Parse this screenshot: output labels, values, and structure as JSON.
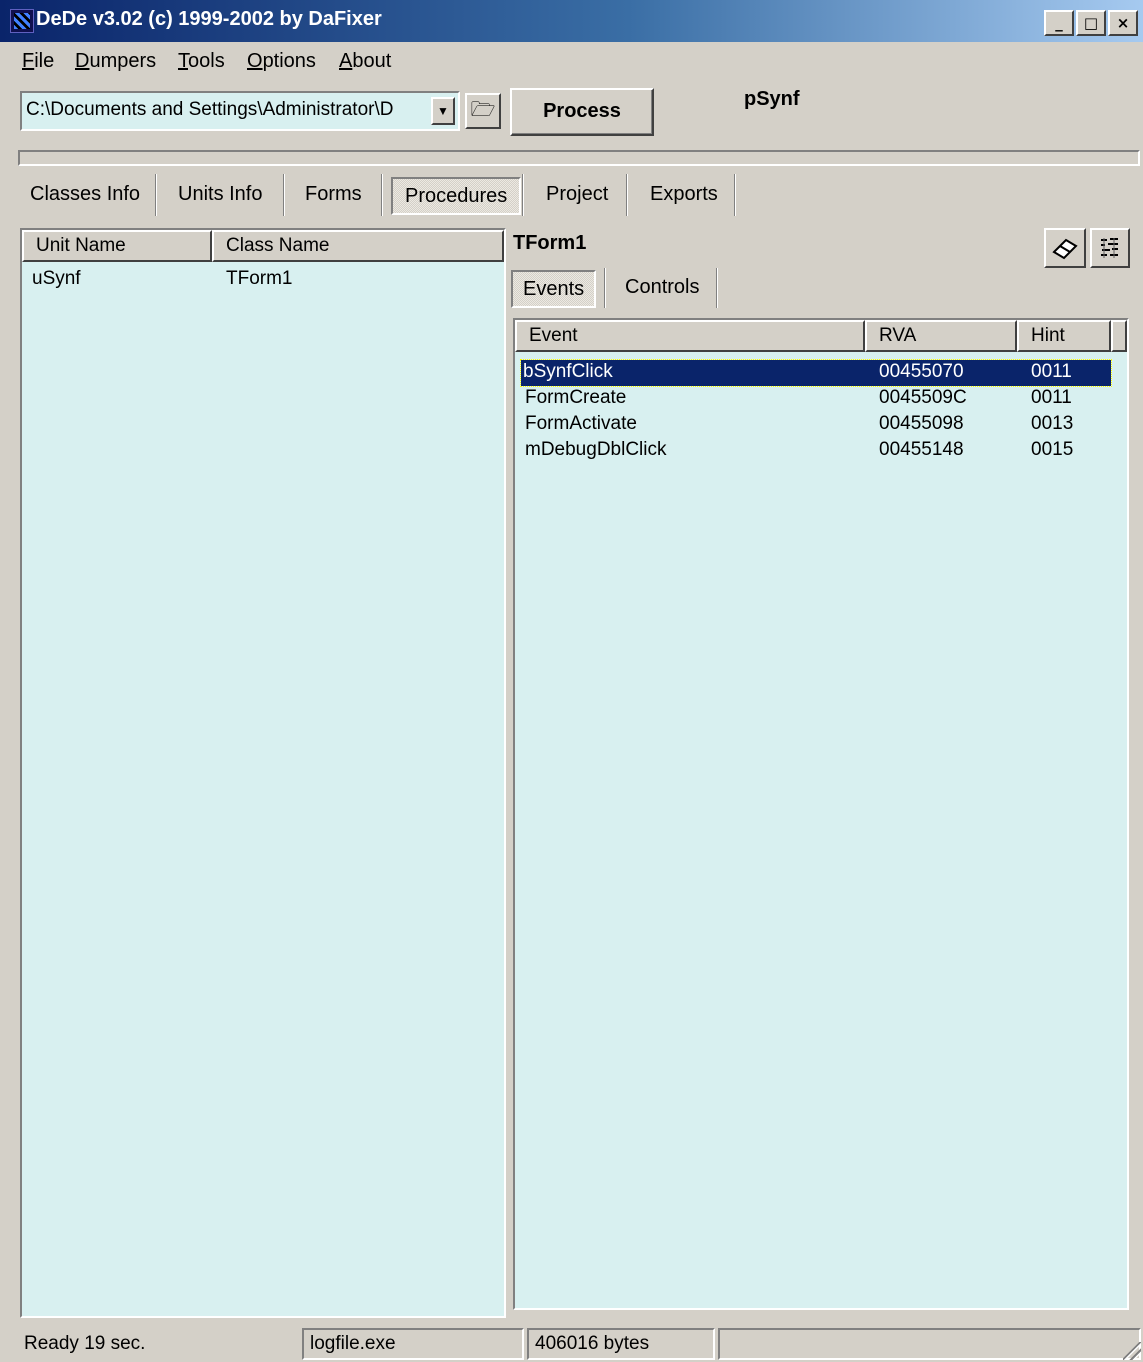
{
  "window": {
    "title": "DeDe v3.02 (c) 1999-2002 by DaFixer"
  },
  "caption_buttons": {
    "minimize": "_",
    "maximize": "□",
    "close": "×"
  },
  "menu": [
    {
      "label": "File",
      "accel": "F",
      "rest": "ile"
    },
    {
      "label": "Dumpers",
      "accel": "D",
      "rest": "umpers"
    },
    {
      "label": "Tools",
      "accel": "T",
      "rest": "ools"
    },
    {
      "label": "Options",
      "accel": "O",
      "rest": "ptions"
    },
    {
      "label": "About",
      "accel": "A",
      "rest": "bout"
    }
  ],
  "toolbar": {
    "path_value": "C:\\Documents and Settings\\Administrator\\D",
    "process_label": "Process",
    "project_name": "pSynf"
  },
  "tabs": [
    "Classes Info",
    "Units Info",
    "Forms",
    "Procedures",
    "Project",
    "Exports"
  ],
  "active_tab": "Procedures",
  "units_table": {
    "columns": [
      "Unit Name",
      "Class Name"
    ],
    "rows": [
      {
        "unit": "uSynf",
        "class": "TForm1"
      }
    ]
  },
  "form_panel": {
    "title": "TForm1",
    "subtabs": [
      "Events",
      "Controls"
    ],
    "active_subtab": "Events",
    "icons": [
      "eraser-icon",
      "disassemble-icon"
    ]
  },
  "events_table": {
    "columns": [
      "Event",
      "RVA",
      "Hint"
    ],
    "rows": [
      {
        "event": "bSynfClick",
        "rva": "00455070",
        "hint": "0011",
        "selected": true
      },
      {
        "event": "FormCreate",
        "rva": "0045509C",
        "hint": "0011",
        "selected": false
      },
      {
        "event": "FormActivate",
        "rva": "00455098",
        "hint": "0013",
        "selected": false
      },
      {
        "event": "mDebugDblClick",
        "rva": "00455148",
        "hint": "0015",
        "selected": false
      }
    ]
  },
  "status_bar": {
    "state": "Ready 19 sec.",
    "file": "logfile.exe",
    "size": "406016 bytes"
  },
  "colors": {
    "list_bg": "#d8f0f0",
    "selection": "#0a246a",
    "face": "#d4d0c8"
  }
}
